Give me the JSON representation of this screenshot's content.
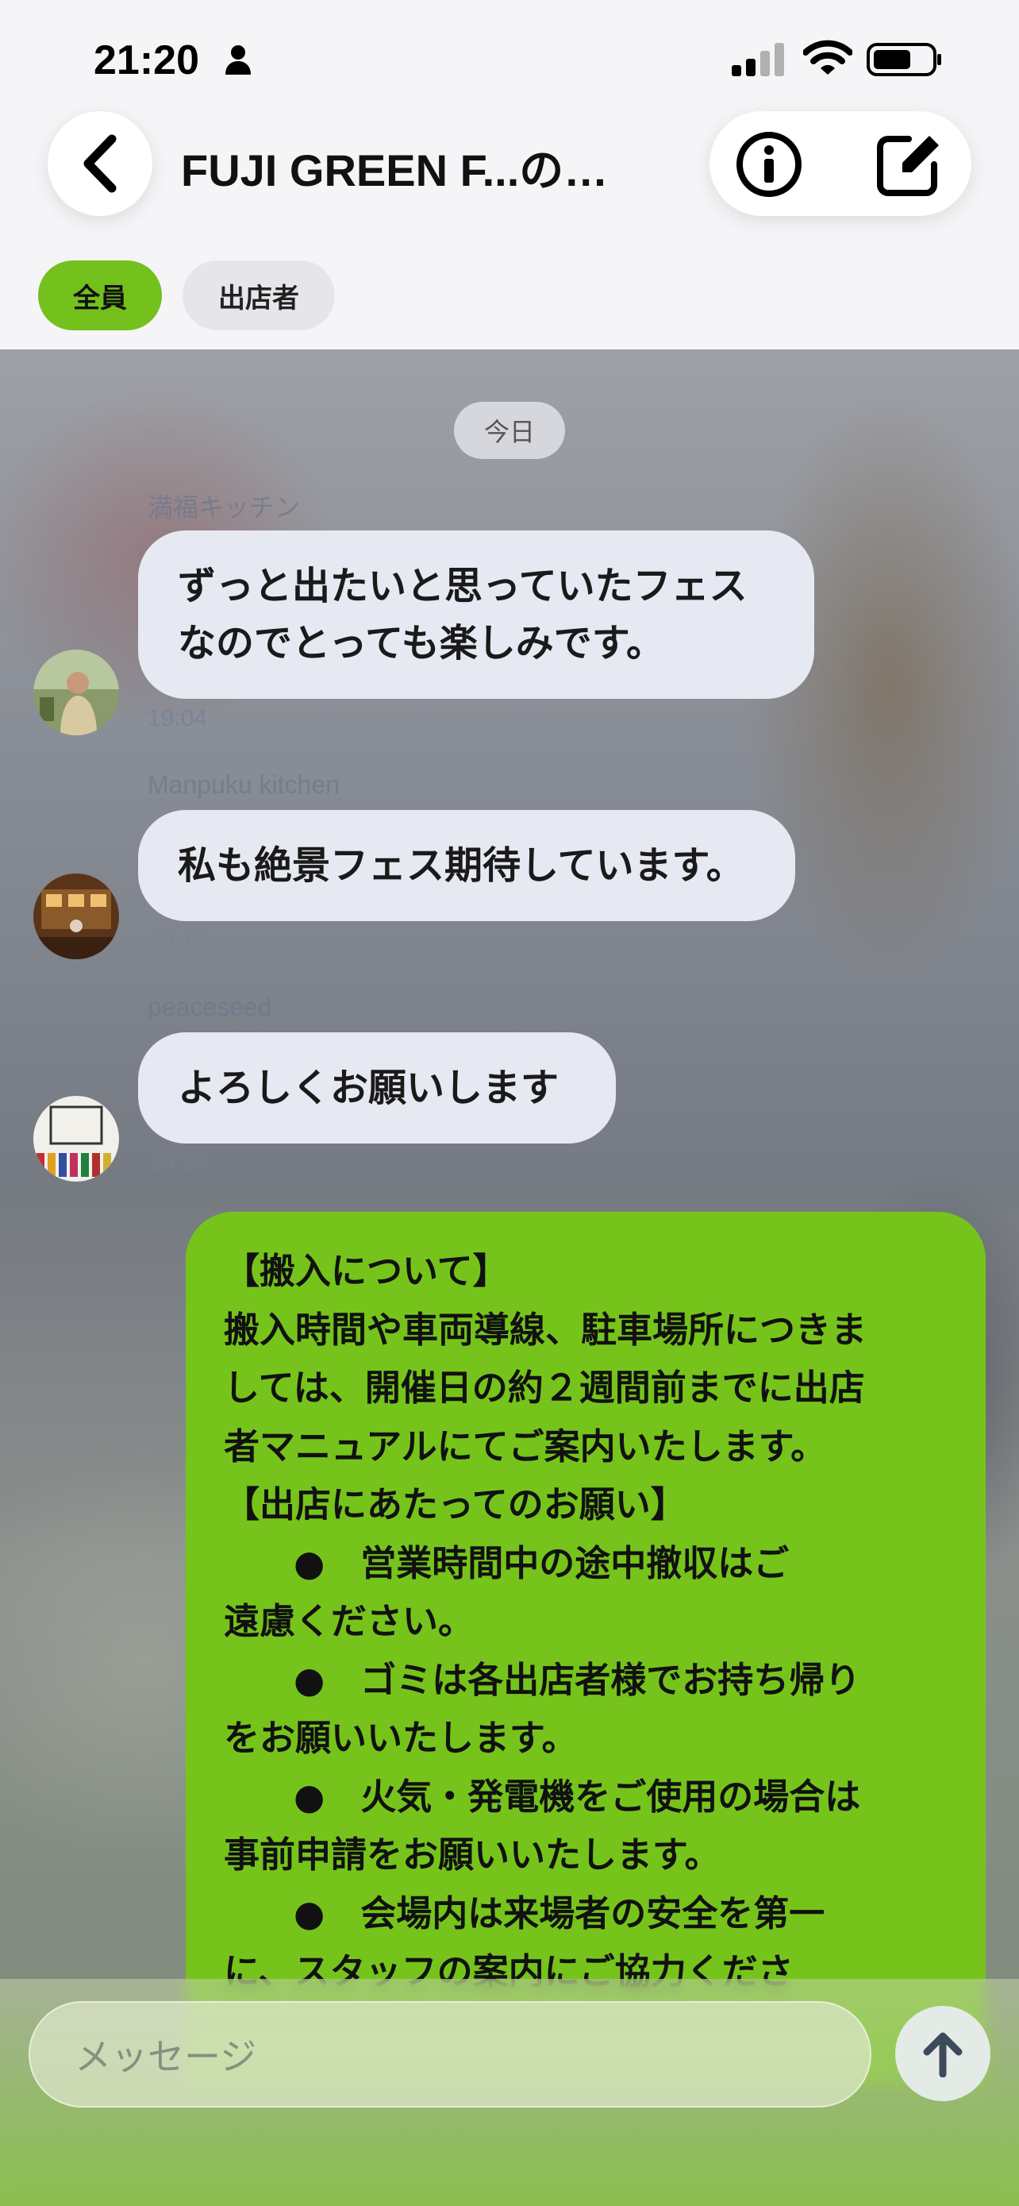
{
  "status_bar": {
    "time": "21:20"
  },
  "header": {
    "title": "FUJI GREEN F...の…",
    "tabs": [
      {
        "label": "全員",
        "active": true
      },
      {
        "label": "出店者",
        "active": false
      }
    ]
  },
  "chat": {
    "date_label": "今日",
    "messages": [
      {
        "sender": "満福キッチン",
        "lines": [
          "ずっと出たいと思っていたフェス",
          "なのでとっても楽しみです。"
        ],
        "time": "19:04"
      },
      {
        "sender": "Manpuku kitchen",
        "lines": [
          "私も絶景フェス期待しています。"
        ],
        "time": "19:17"
      },
      {
        "sender": "peaceseed",
        "lines": [
          "よろしくお願いします"
        ],
        "time": "19:30"
      }
    ],
    "own_message_lines": [
      "【搬入について】",
      "搬入時間や車両導線、駐車場所につきま",
      "しては、開催日の約２週間前までに出店",
      "者マニュアルにてご案内いたします。",
      "【出店にあたってのお願い】",
      "●　営業時間中の途中撤収はご",
      "遠慮ください。",
      "●　ゴミは各出店者様でお持ち帰り",
      "をお願いいたします。",
      "●　火気・発電機をご使用の場合は",
      "事前申請をお願いいたします。",
      "●　会場内は来場者の安全を第一",
      "に、スタッフの案内にご協力くださ"
    ]
  },
  "composer": {
    "placeholder": "メッセージ"
  },
  "colors": {
    "accent_green": "#76c41b",
    "incoming_bubble": "#e6e9f2"
  }
}
